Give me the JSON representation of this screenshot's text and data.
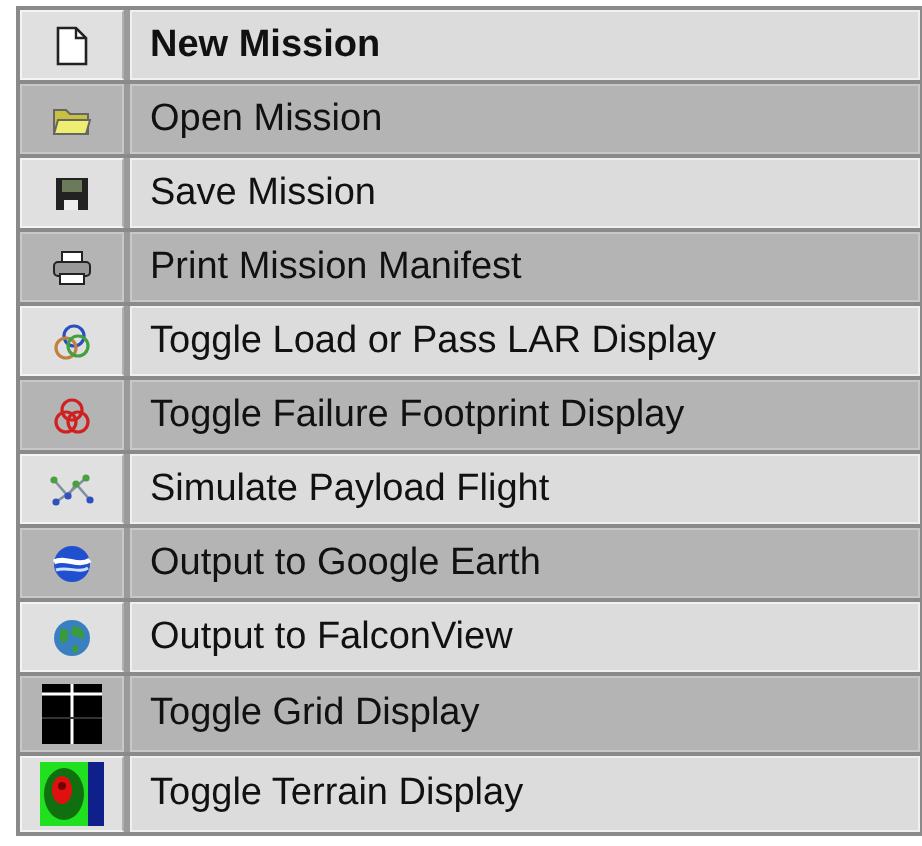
{
  "menu": {
    "items": [
      {
        "label": "New Mission",
        "kind": "heading"
      },
      {
        "label": "Open Mission",
        "kind": "command"
      },
      {
        "label": "Save Mission",
        "kind": "command"
      },
      {
        "label": "Print Mission Manifest",
        "kind": "command"
      },
      {
        "label": "Toggle Load or Pass LAR Display",
        "kind": "command"
      },
      {
        "label": "Toggle Failure Footprint Display",
        "kind": "command"
      },
      {
        "label": "Simulate Payload Flight",
        "kind": "command"
      },
      {
        "label": "Output to Google Earth",
        "kind": "command"
      },
      {
        "label": "Output to FalconView",
        "kind": "command"
      },
      {
        "label": "Toggle Grid Display",
        "kind": "command"
      },
      {
        "label": "Toggle Terrain Display",
        "kind": "command"
      }
    ]
  }
}
